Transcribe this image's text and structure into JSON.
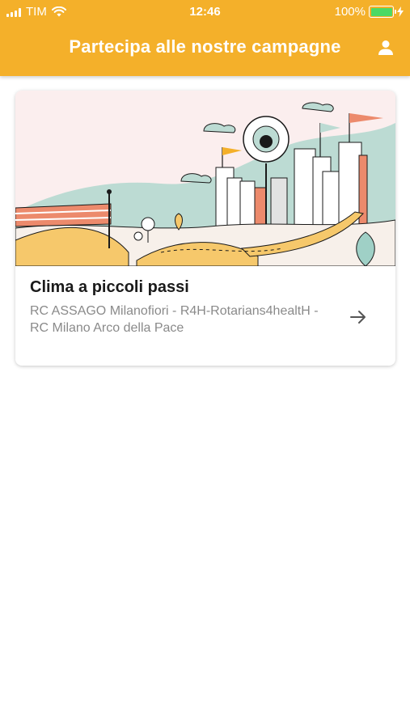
{
  "status_bar": {
    "carrier": "TIM",
    "time": "12:46",
    "battery": "100%"
  },
  "header": {
    "title": "Partecipa alle nostre campagne",
    "profile_icon": "person-icon"
  },
  "campaigns": [
    {
      "title": "Clima a piccoli passi",
      "subtitle": "RC ASSAGO Milanofiori - R4H-Rotarians4healtH - RC Milano Arco della Pace",
      "arrow_icon": "arrow-right-icon",
      "image": "city-landscape-illustration"
    }
  ],
  "colors": {
    "accent": "#f4b02a",
    "battery_green": "#4cd964"
  }
}
